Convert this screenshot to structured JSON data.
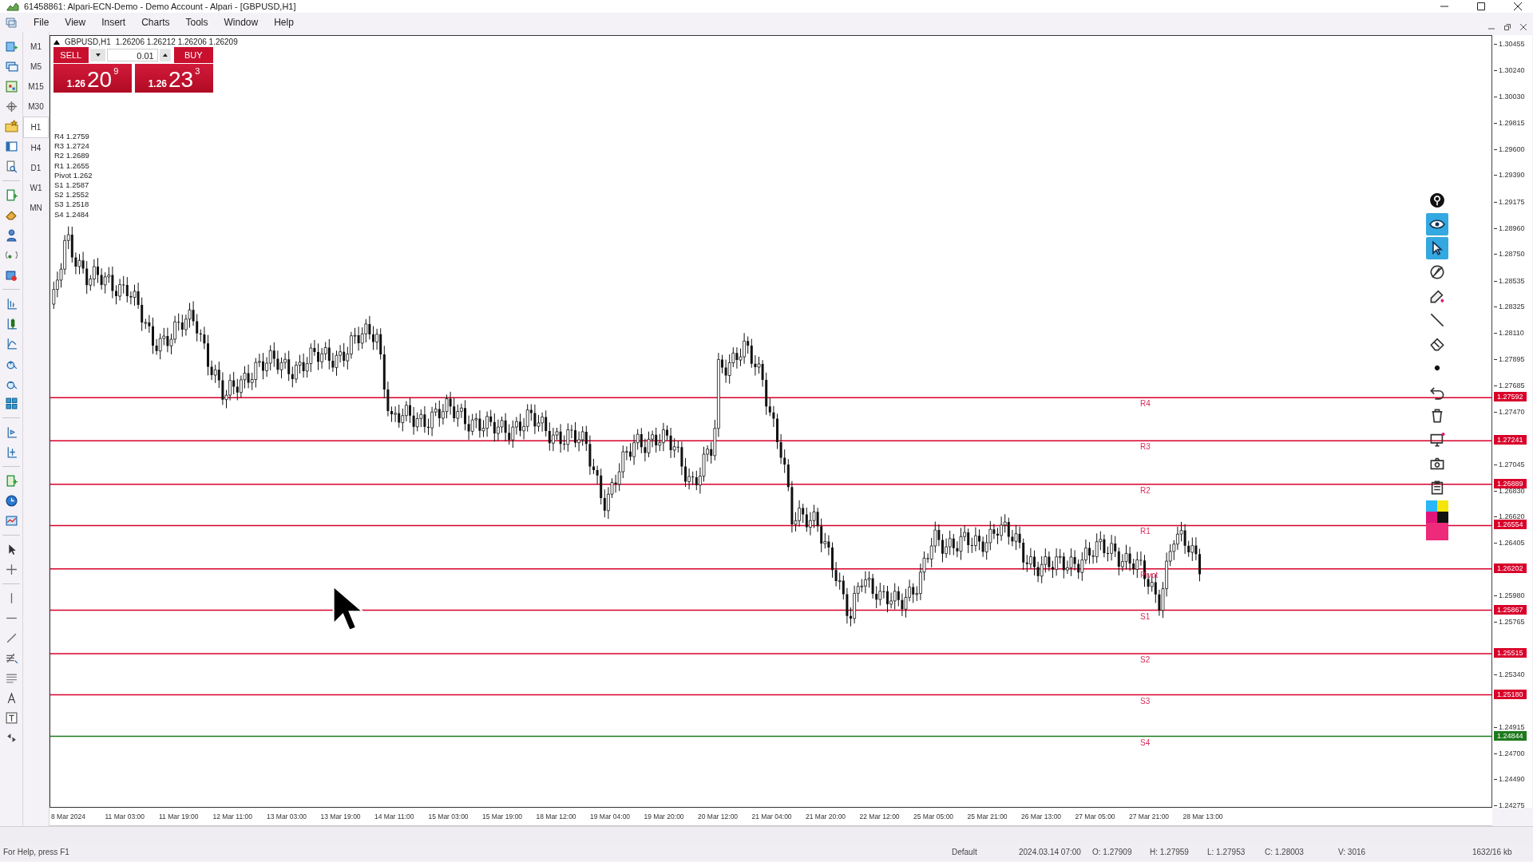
{
  "window": {
    "title": "61458861: Alpari-ECN-Demo - Demo Account - Alpari - [GBPUSD,H1]"
  },
  "menu": [
    "File",
    "View",
    "Insert",
    "Charts",
    "Tools",
    "Window",
    "Help"
  ],
  "timeframes": [
    {
      "label": "M1",
      "selected": false
    },
    {
      "label": "M5",
      "selected": false
    },
    {
      "label": "M15",
      "selected": false
    },
    {
      "label": "M30",
      "selected": false
    },
    {
      "label": "H1",
      "selected": true
    },
    {
      "label": "H4",
      "selected": false
    },
    {
      "label": "D1",
      "selected": false
    },
    {
      "label": "W1",
      "selected": false
    },
    {
      "label": "MN",
      "selected": false
    }
  ],
  "chart": {
    "header": {
      "symbol": "GBPUSD,H1",
      "ohlc": "1.26206 1.26212 1.26206 1.26209"
    },
    "trade_panel": {
      "sell_label": "SELL",
      "buy_label": "BUY",
      "lot": "0.01",
      "sell_price": {
        "big_figure": "1.26",
        "pips": "20",
        "fraction": "9"
      },
      "buy_price": {
        "big_figure": "1.26",
        "pips": "23",
        "fraction": "3"
      }
    },
    "pivot_info": [
      "R4 1.2759",
      "R3 1.2724",
      "R2 1.2689",
      "R1 1.2655",
      "Pivot 1.262",
      "S1 1.2587",
      "S2 1.2552",
      "S3 1.2518",
      "S4 1.2484"
    ],
    "levels": [
      {
        "label": "R4",
        "price_tag": "1.27592",
        "color": "#d8002a"
      },
      {
        "label": "R3",
        "price_tag": "1.27241",
        "color": "#d8002a"
      },
      {
        "label": "R2",
        "price_tag": "1.26889",
        "color": "#d8002a"
      },
      {
        "label": "R1",
        "price_tag": "1.26554",
        "color": "#d8002a"
      },
      {
        "label": "Pivot",
        "price_tag": "1.26202",
        "color": "#d8002a"
      },
      {
        "label": "S1",
        "price_tag": "1.25867",
        "color": "#d8002a"
      },
      {
        "label": "S2",
        "price_tag": "1.25515",
        "color": "#d8002a"
      },
      {
        "label": "S3",
        "price_tag": "1.25180",
        "color": "#d8002a"
      },
      {
        "label": "S4",
        "price_tag": "1.24844",
        "color": "#1e7a1e"
      }
    ],
    "price_ticks": [
      "1.30455",
      "1.30240",
      "1.30030",
      "1.29815",
      "1.29600",
      "1.29390",
      "1.29175",
      "1.28960",
      "1.28750",
      "1.28535",
      "1.28325",
      "1.28110",
      "1.27895",
      "1.27685",
      "1.27470",
      "1.27045",
      "1.26830",
      "1.26620",
      "1.26405",
      "1.25980",
      "1.25765",
      "1.25340",
      "1.24915",
      "1.24700",
      "1.24490",
      "1.24275"
    ],
    "time_ticks": [
      "8 Mar 2024",
      "11 Mar 03:00",
      "11 Mar 19:00",
      "12 Mar 11:00",
      "13 Mar 03:00",
      "13 Mar 19:00",
      "14 Mar 11:00",
      "15 Mar 03:00",
      "15 Mar 19:00",
      "18 Mar 12:00",
      "19 Mar 04:00",
      "19 Mar 20:00",
      "20 Mar 12:00",
      "21 Mar 04:00",
      "21 Mar 20:00",
      "22 Mar 12:00",
      "25 Mar 05:00",
      "25 Mar 21:00",
      "26 Mar 13:00",
      "27 Mar 05:00",
      "27 Mar 21:00",
      "28 Mar 13:00"
    ],
    "drawing_tools": [
      {
        "selected": false
      },
      {
        "selected": true
      },
      {
        "selected": true
      },
      {
        "selected": false
      },
      {
        "selected": false
      },
      {
        "selected": false
      },
      {
        "selected": false
      },
      {
        "selected": false
      },
      {
        "selected": false
      },
      {
        "selected": false
      },
      {
        "selected": false
      },
      {
        "selected": false
      },
      {
        "selected": false
      }
    ]
  },
  "status_bar": {
    "help": "For Help, press F1",
    "profile": "Default",
    "datetime": "2024.03.14 07:00",
    "open": "O: 1.27909",
    "high": "H: 1.27959",
    "low": "L: 1.27953",
    "close": "C: 1.28003",
    "volume": "V: 3016",
    "traffic": "1632/16 kb"
  }
}
